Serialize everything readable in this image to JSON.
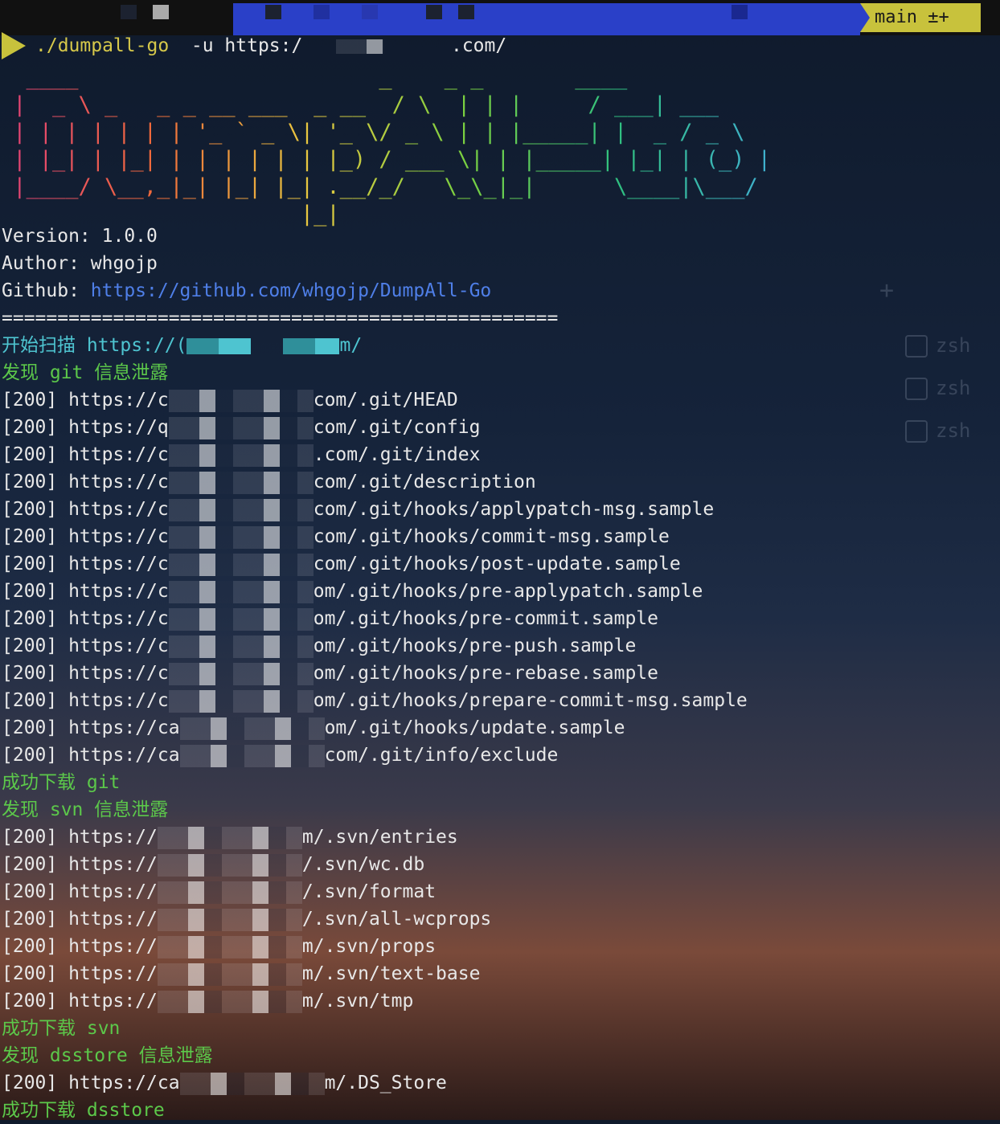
{
  "prompt": {
    "branch": "main ±+",
    "command": "./dumpall-go",
    "args_prefix": "  -u https:/",
    "args_suffix": ".com/"
  },
  "banner": {
    "ascii": "  ____                       _    _ _       ____\n |  _ \\ _   _ _ __ ___  _ __  / \\  | | |     / ___| ___\n | | | | | | | '_ ` _ \\| '_ \\/ _ \\ | | |_____| |  _ / _ \\\n | |_| | |_| | | | | | | |_) / ___ \\| | |_____| |_| | (_) |\n |____/ \\__,_|_| |_| |_| .__/_/   \\_\\_|_|      \\____|\\___/\n                       |_|"
  },
  "info": {
    "version": "Version: 1.0.0",
    "author": "Author: whgojp",
    "github_label": "Github: ",
    "github_url": "https://github.com/whgojp/DumpAll-Go",
    "separator": "=================================================="
  },
  "scan": {
    "start_prefix": "开始扫描 https://(",
    "start_suffix": "m/",
    "sections": [
      {
        "found": "发现 git 信息泄露",
        "rows": [
          {
            "prefix": "[200] https://c",
            "suffix": "com/.git/HEAD"
          },
          {
            "prefix": "[200] https://q",
            "suffix": "com/.git/config"
          },
          {
            "prefix": "[200] https://c",
            "suffix": ".com/.git/index"
          },
          {
            "prefix": "[200] https://c",
            "suffix": "com/.git/description"
          },
          {
            "prefix": "[200] https://c",
            "suffix": "com/.git/hooks/applypatch-msg.sample"
          },
          {
            "prefix": "[200] https://c",
            "suffix": "com/.git/hooks/commit-msg.sample"
          },
          {
            "prefix": "[200] https://c",
            "suffix": "com/.git/hooks/post-update.sample"
          },
          {
            "prefix": "[200] https://c",
            "suffix": "om/.git/hooks/pre-applypatch.sample"
          },
          {
            "prefix": "[200] https://c",
            "suffix": "om/.git/hooks/pre-commit.sample"
          },
          {
            "prefix": "[200] https://c",
            "suffix": "om/.git/hooks/pre-push.sample"
          },
          {
            "prefix": "[200] https://c",
            "suffix": "om/.git/hooks/pre-rebase.sample"
          },
          {
            "prefix": "[200] https://c",
            "suffix": "om/.git/hooks/prepare-commit-msg.sample"
          },
          {
            "prefix": "[200] https://ca",
            "suffix": "om/.git/hooks/update.sample"
          },
          {
            "prefix": "[200] https://ca",
            "suffix": "com/.git/info/exclude"
          }
        ],
        "done": "成功下载 git"
      },
      {
        "found": "发现 svn 信息泄露",
        "rows": [
          {
            "prefix": "[200] https://",
            "suffix": "m/.svn/entries"
          },
          {
            "prefix": "[200] https://",
            "suffix": "/.svn/wc.db"
          },
          {
            "prefix": "[200] https://",
            "suffix": "/.svn/format"
          },
          {
            "prefix": "[200] https://",
            "suffix": "/.svn/all-wcprops"
          },
          {
            "prefix": "[200] https://",
            "suffix": "m/.svn/props"
          },
          {
            "prefix": "[200] https://",
            "suffix": "m/.svn/text-base"
          },
          {
            "prefix": "[200] https://",
            "suffix": "m/.svn/tmp"
          }
        ],
        "done": "成功下载 svn"
      },
      {
        "found": "发现 dsstore 信息泄露",
        "rows": [
          {
            "prefix": "[200] https://ca",
            "suffix": "m/.DS_Store"
          }
        ],
        "done": "成功下载 dsstore"
      }
    ]
  },
  "side_tabs": [
    "zsh",
    "zsh",
    "zsh"
  ],
  "colors": {
    "accent_yellow": "#c8c23c",
    "link_blue": "#4f7fe8",
    "cyan": "#4ec4d0",
    "green": "#5cc84a"
  }
}
